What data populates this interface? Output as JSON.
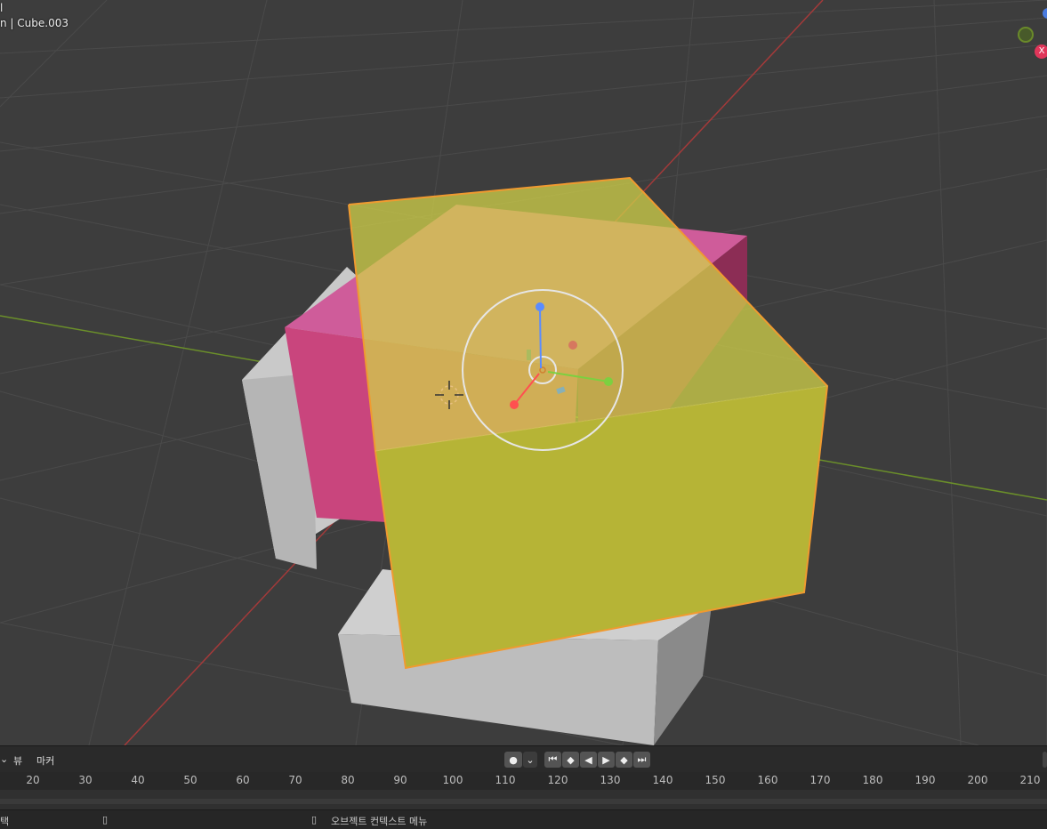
{
  "viewport": {
    "overlay_line1": "l",
    "overlay_line2": "n | Cube.003",
    "nav_gizmo": {
      "x_axis_label": "X"
    }
  },
  "timeline": {
    "menu_dropdown": "⌄",
    "menu_view": "뷰",
    "menu_marker": "마커",
    "record_icon": "●",
    "record_dropdown": "⌄",
    "jump_start": "⏮",
    "prev_keyframe": "◆",
    "play_reverse": "◀",
    "play": "▶",
    "next_keyframe": "◆",
    "jump_end": "⏭",
    "ruler_ticks": [
      "20",
      "30",
      "40",
      "50",
      "60",
      "70",
      "80",
      "90",
      "100",
      "110",
      "120",
      "130",
      "140",
      "150",
      "160",
      "170",
      "180",
      "190",
      "200",
      "210"
    ]
  },
  "status_bar": {
    "left_text": "택",
    "context_menu_label": "오브젝트 컨텍스트 메뉴"
  },
  "colors": {
    "viewport_bg": "#3d3d3d",
    "grid": "#4a4a4a",
    "x_axis": "#a33a3a",
    "y_axis": "#6b8f2a",
    "yellow_cube": "#b8b437",
    "pink_cube": "#d44a8a",
    "white_cube": "#c8c8c8",
    "selection_outline": "#f09a30"
  }
}
